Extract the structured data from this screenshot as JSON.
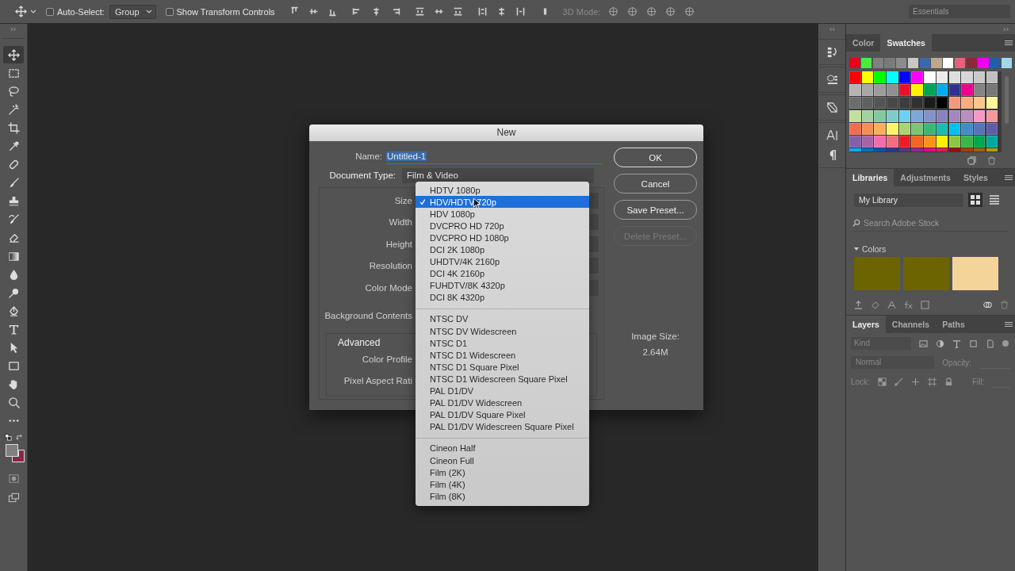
{
  "options_bar": {
    "auto_select": {
      "label": "Auto-Select:",
      "checked": false
    },
    "auto_select_target": "Group",
    "transform_controls": {
      "label": "Show Transform Controls",
      "checked": false
    },
    "mode_3d_label": "3D Mode:",
    "workspace": "Essentials"
  },
  "toolbar": {
    "tools": [
      {
        "kind": "move",
        "selected": true
      },
      {
        "kind": "marquee",
        "selected": false
      },
      {
        "kind": "lasso",
        "selected": false
      },
      {
        "kind": "wand",
        "selected": false
      },
      {
        "kind": "crop",
        "selected": false
      },
      {
        "kind": "eyedropper",
        "selected": false
      },
      {
        "kind": "healing",
        "selected": false
      },
      {
        "kind": "brush",
        "selected": false
      },
      {
        "kind": "stamp",
        "selected": false
      },
      {
        "kind": "history",
        "selected": false
      },
      {
        "kind": "eraser",
        "selected": false
      },
      {
        "kind": "gradient",
        "selected": false
      },
      {
        "kind": "blur",
        "selected": false
      },
      {
        "kind": "dodge",
        "selected": false
      },
      {
        "kind": "pen",
        "selected": false
      },
      {
        "kind": "type",
        "selected": false
      },
      {
        "kind": "select",
        "selected": false
      },
      {
        "kind": "rectangle",
        "selected": false
      },
      {
        "kind": "hand",
        "selected": false
      },
      {
        "kind": "zoom",
        "selected": false
      },
      {
        "kind": "more",
        "selected": false
      }
    ],
    "colors": [
      {
        "kind": "foreground",
        "color": "#808080"
      },
      {
        "kind": "background",
        "color": "#8a2645"
      }
    ]
  },
  "dialog": {
    "title": "New",
    "name_label": "Name:",
    "name_value": "Untitled-1",
    "document_type_label": "Document Type:",
    "document_type": "Film & Video",
    "field_labels": [
      "Size",
      "Width",
      "Height",
      "Resolution",
      "Color Mode"
    ],
    "background_label": "Background Contents",
    "advanced": {
      "title": "Advanced",
      "field_labels": [
        "Color Profile",
        "Pixel Aspect Rati"
      ]
    },
    "buttons": [
      {
        "label": "OK",
        "kind": "default",
        "disabled": false
      },
      {
        "label": "Cancel",
        "kind": "normal",
        "disabled": false
      },
      {
        "label": "Save Preset...",
        "kind": "normal",
        "disabled": false
      },
      {
        "label": "Delete Preset...",
        "kind": "normal",
        "disabled": true
      }
    ],
    "image_size_label": "Image Size:",
    "image_size": "2.64M",
    "size_menu": {
      "groups": [
        [
          {
            "label": "HDTV 1080p",
            "selected": false
          },
          {
            "label": "HDV/HDTV 720p",
            "selected": true
          },
          {
            "label": "HDV 1080p",
            "selected": false
          },
          {
            "label": "DVCPRO HD 720p",
            "selected": false
          },
          {
            "label": "DVCPRO HD 1080p",
            "selected": false
          },
          {
            "label": "DCI 2K 1080p",
            "selected": false
          },
          {
            "label": "UHDTV/4K 2160p",
            "selected": false
          },
          {
            "label": "DCI 4K 2160p",
            "selected": false
          },
          {
            "label": "FUHDTV/8K 4320p",
            "selected": false
          },
          {
            "label": "DCI 8K 4320p",
            "selected": false
          }
        ],
        [
          {
            "label": "NTSC DV",
            "selected": false
          },
          {
            "label": "NTSC DV Widescreen",
            "selected": false
          },
          {
            "label": "NTSC D1",
            "selected": false
          },
          {
            "label": "NTSC D1 Widescreen",
            "selected": false
          },
          {
            "label": "NTSC D1 Square Pixel",
            "selected": false
          },
          {
            "label": "NTSC D1 Widescreen Square Pixel",
            "selected": false
          },
          {
            "label": "PAL D1/DV",
            "selected": false
          },
          {
            "label": "PAL D1/DV Widescreen",
            "selected": false
          },
          {
            "label": "PAL D1/DV Square Pixel",
            "selected": false
          },
          {
            "label": "PAL D1/DV Widescreen Square Pixel",
            "selected": false
          }
        ],
        [
          {
            "label": "Cineon Half",
            "selected": false
          },
          {
            "label": "Cineon Full",
            "selected": false
          },
          {
            "label": "Film (2K)",
            "selected": false
          },
          {
            "label": "Film (4K)",
            "selected": false
          },
          {
            "label": "Film (8K)",
            "selected": false
          }
        ]
      ]
    }
  },
  "swatches_panel": {
    "tabs": [
      {
        "label": "Color",
        "selected": false
      },
      {
        "label": "Swatches",
        "selected": true
      }
    ],
    "recent": [
      {
        "color": "#e8001a"
      },
      {
        "color": "#3ff03f"
      },
      {
        "color": "#808080"
      },
      {
        "color": "#7a7a7a"
      },
      {
        "color": "#8c8c8c"
      },
      {
        "color": "#c8c8c8"
      },
      {
        "color": "#3a68b0"
      },
      {
        "color": "#bba88f"
      },
      {
        "color": "#ffffff"
      },
      {
        "color": "#e8607a"
      },
      {
        "color": "#8a2a3a"
      },
      {
        "color": "#f000f0"
      },
      {
        "color": "#1f5fb0"
      },
      {
        "color": "#a0d8f0"
      }
    ],
    "swatches": [
      {
        "color": "#ff0000"
      },
      {
        "color": "#ffff00"
      },
      {
        "color": "#00ff00"
      },
      {
        "color": "#00ffff"
      },
      {
        "color": "#0000ff"
      },
      {
        "color": "#ff00ff"
      },
      {
        "color": "#ffffff"
      },
      {
        "color": "#ebebeb"
      },
      {
        "color": "#dedede"
      },
      {
        "color": "#d6d6d6"
      },
      {
        "color": "#cacaca"
      },
      {
        "color": "#c0c0c0"
      },
      {
        "color": "#b4b4b4"
      },
      {
        "color": "#a8a8a8"
      },
      {
        "color": "#9c9c9c"
      },
      {
        "color": "#909090"
      },
      {
        "color": "#e8102a"
      },
      {
        "color": "#fff200"
      },
      {
        "color": "#00a651"
      },
      {
        "color": "#00aeef"
      },
      {
        "color": "#2e3192"
      },
      {
        "color": "#ec008c"
      },
      {
        "color": "#848484"
      },
      {
        "color": "#787878"
      },
      {
        "color": "#6c6c6c"
      },
      {
        "color": "#606060"
      },
      {
        "color": "#545454"
      },
      {
        "color": "#484848"
      },
      {
        "color": "#3c3c3c"
      },
      {
        "color": "#303030"
      },
      {
        "color": "#1a1a1a"
      },
      {
        "color": "#000000"
      },
      {
        "color": "#f7977a"
      },
      {
        "color": "#f9ad81"
      },
      {
        "color": "#fdc68a"
      },
      {
        "color": "#fff79a"
      },
      {
        "color": "#c4df9b"
      },
      {
        "color": "#a3d39c"
      },
      {
        "color": "#82ca9d"
      },
      {
        "color": "#7bcdc8"
      },
      {
        "color": "#6ecff6"
      },
      {
        "color": "#7ea7d8"
      },
      {
        "color": "#8493ca"
      },
      {
        "color": "#8882be"
      },
      {
        "color": "#a187be"
      },
      {
        "color": "#bc8dbf"
      },
      {
        "color": "#f49ac2"
      },
      {
        "color": "#f6989d"
      },
      {
        "color": "#f26c4f"
      },
      {
        "color": "#f68e55"
      },
      {
        "color": "#fbaf5c"
      },
      {
        "color": "#fff467"
      },
      {
        "color": "#acd372"
      },
      {
        "color": "#7cc576"
      },
      {
        "color": "#3bb878"
      },
      {
        "color": "#1abbb4"
      },
      {
        "color": "#00bff3"
      },
      {
        "color": "#438cca"
      },
      {
        "color": "#5574b9"
      },
      {
        "color": "#605ca8"
      },
      {
        "color": "#855fa8"
      },
      {
        "color": "#a763a8"
      },
      {
        "color": "#f06eaa"
      },
      {
        "color": "#f26d7d"
      },
      {
        "color": "#ed1c24"
      },
      {
        "color": "#f26522"
      },
      {
        "color": "#f7941d"
      },
      {
        "color": "#fff200"
      },
      {
        "color": "#8dc73f"
      },
      {
        "color": "#39b54a"
      },
      {
        "color": "#00a651"
      },
      {
        "color": "#00a99d"
      },
      {
        "color": "#00aeef"
      },
      {
        "color": "#0072bc"
      },
      {
        "color": "#0054a6"
      },
      {
        "color": "#2e3192"
      },
      {
        "color": "#662d91"
      },
      {
        "color": "#92278f"
      },
      {
        "color": "#ec008c"
      },
      {
        "color": "#ed145b"
      },
      {
        "color": "#9e0b0f"
      },
      {
        "color": "#a0410d"
      },
      {
        "color": "#a36209"
      },
      {
        "color": "#aba000"
      }
    ]
  },
  "libraries_panel": {
    "tabs": [
      {
        "label": "Libraries",
        "selected": true
      },
      {
        "label": "Adjustments",
        "selected": false
      },
      {
        "label": "Styles",
        "selected": false
      }
    ],
    "library": "My Library",
    "view_buttons": [
      {
        "kind": "grid",
        "selected": true
      },
      {
        "kind": "list",
        "selected": false
      }
    ],
    "search_placeholder": "Search Adobe Stock",
    "section": {
      "title": "Colors",
      "expanded": true
    },
    "colors": [
      {
        "color": "#6b6400"
      },
      {
        "color": "#6b6400"
      },
      {
        "color": "#f5d49a"
      }
    ]
  },
  "layers_panel": {
    "tabs": [
      {
        "label": "Layers",
        "selected": true
      },
      {
        "label": "Channels",
        "selected": false
      },
      {
        "label": "Paths",
        "selected": false
      }
    ],
    "filter": "Kind",
    "blend_mode": "Normal",
    "opacity_label": "Opacity:",
    "lock_label": "Lock:",
    "fill_label": "Fill:"
  }
}
